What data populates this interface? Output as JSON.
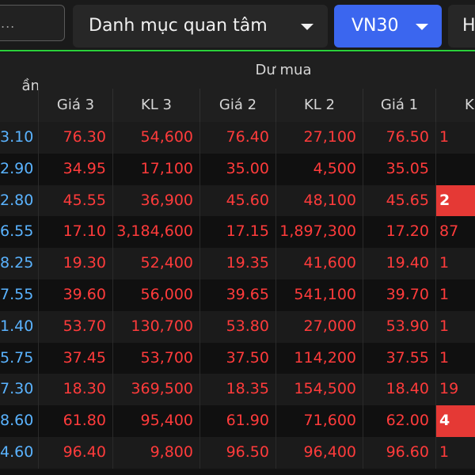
{
  "toolbar": {
    "search_placeholder": "...",
    "watchlist_label": "Danh mục quan tâm",
    "index_label": "VN30",
    "next_label": "H"
  },
  "accent_colors": {
    "active_dropdown": "#3b66ef",
    "divider": "#2bd03b",
    "price_down": "#ff3b3b",
    "reference": "#5ab3ff"
  },
  "table": {
    "left_header": "ần",
    "group_header": "Dư mua",
    "columns": [
      "Giá 3",
      "KL 3",
      "Giá 2",
      "KL 2",
      "Giá 1",
      "K"
    ],
    "rows": [
      {
        "ref": "3.10",
        "gia3": "76.30",
        "kl3": "54,600",
        "gia2": "76.40",
        "kl2": "27,100",
        "gia1": "76.50",
        "kl1": "1"
      },
      {
        "ref": "2.90",
        "gia3": "34.95",
        "kl3": "17,100",
        "gia2": "35.00",
        "kl2": "4,500",
        "gia1": "35.05",
        "kl1": ""
      },
      {
        "ref": "2.80",
        "gia3": "45.55",
        "kl3": "36,900",
        "gia2": "45.60",
        "kl2": "48,100",
        "gia1": "45.65",
        "kl1": "2"
      },
      {
        "ref": "6.55",
        "gia3": "17.10",
        "kl3": "3,184,600",
        "gia2": "17.15",
        "kl2": "1,897,300",
        "gia1": "17.20",
        "kl1": "87"
      },
      {
        "ref": "8.25",
        "gia3": "19.30",
        "kl3": "52,400",
        "gia2": "19.35",
        "kl2": "41,600",
        "gia1": "19.40",
        "kl1": "1"
      },
      {
        "ref": "7.55",
        "gia3": "39.60",
        "kl3": "56,000",
        "gia2": "39.65",
        "kl2": "541,100",
        "gia1": "39.70",
        "kl1": "1"
      },
      {
        "ref": "1.40",
        "gia3": "53.70",
        "kl3": "130,700",
        "gia2": "53.80",
        "kl2": "27,000",
        "gia1": "53.90",
        "kl1": "1"
      },
      {
        "ref": "5.75",
        "gia3": "37.45",
        "kl3": "53,700",
        "gia2": "37.50",
        "kl2": "114,200",
        "gia1": "37.55",
        "kl1": "1"
      },
      {
        "ref": "7.30",
        "gia3": "18.30",
        "kl3": "369,500",
        "gia2": "18.35",
        "kl2": "154,500",
        "gia1": "18.40",
        "kl1": "19"
      },
      {
        "ref": "8.60",
        "gia3": "61.80",
        "kl3": "95,400",
        "gia2": "61.90",
        "kl2": "71,600",
        "gia1": "62.00",
        "kl1": "4"
      },
      {
        "ref": "4.60",
        "gia3": "96.40",
        "kl3": "9,800",
        "gia2": "96.50",
        "kl2": "96,400",
        "gia1": "96.60",
        "kl1": "1"
      }
    ],
    "highlighted_kl1_rows": [
      2,
      9
    ]
  }
}
